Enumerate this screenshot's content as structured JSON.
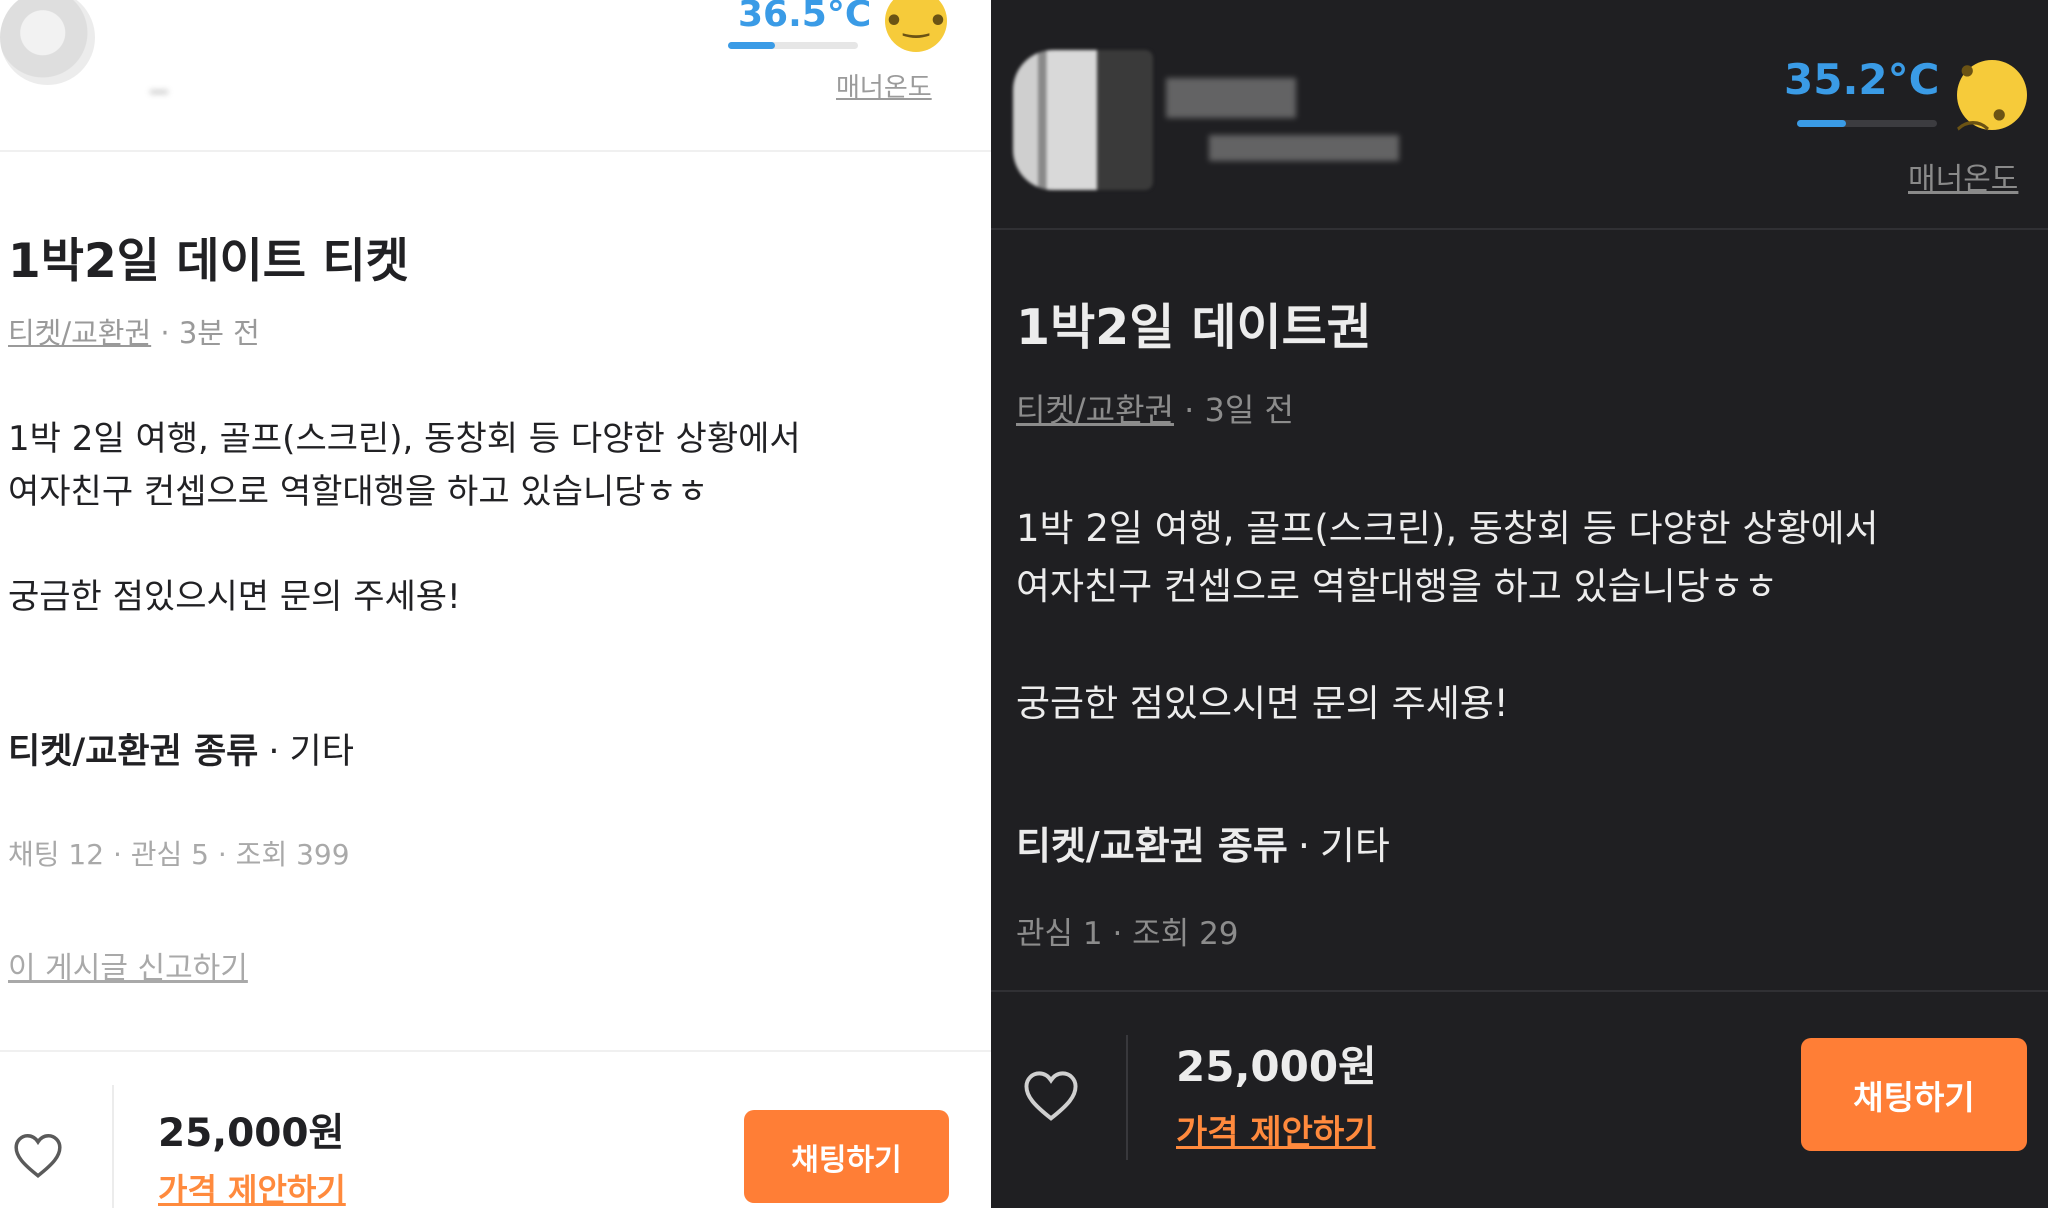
{
  "light": {
    "manner_temp": "36.5°C",
    "manner_temp_fraction": 0.365,
    "manner_label": "매너온도",
    "title": "1박2일 데이트 티켓",
    "category": "티켓/교환권",
    "time": "3분 전",
    "description": "1박 2일 여행, 골프(스크린), 동창회 등 다양한 상황에서\n여자친구 컨셉으로 역할대행을 하고 있습니당ㅎㅎ\n\n궁금한 점있으시면 문의 주세용!",
    "attr_key": "티켓/교환권 종류",
    "attr_value": "기타",
    "stats": "채팅 12 · 관심 5 · 조회 399",
    "report": "이 게시글 신고하기",
    "price": "25,000원",
    "offer": "가격 제안하기",
    "chat_button": "채팅하기"
  },
  "dark": {
    "manner_temp": "35.2°C",
    "manner_temp_fraction": 0.352,
    "manner_label": "매너온도",
    "title": "1박2일 데이트권",
    "category": "티켓/교환권",
    "time": "3일 전",
    "description": "1박 2일 여행, 골프(스크린), 동창회 등 다양한 상황에서\n여자친구 컨셉으로 역할대행을 하고 있습니당ㅎㅎ\n\n궁금한 점있으시면 문의 주세용!",
    "attr_key": "티켓/교환권 종류",
    "attr_value": "기타",
    "stats": "관심 1 · 조회 29",
    "price": "25,000원",
    "offer": "가격 제안하기",
    "chat_button": "채팅하기"
  },
  "colors": {
    "accent_orange": "#ff7e36",
    "temp_blue": "#3a9be6",
    "face_yellow": "#f6cb3a",
    "dark_bg": "#1f1f22"
  },
  "icons": [
    "heart-icon",
    "smiley-face-icon"
  ]
}
